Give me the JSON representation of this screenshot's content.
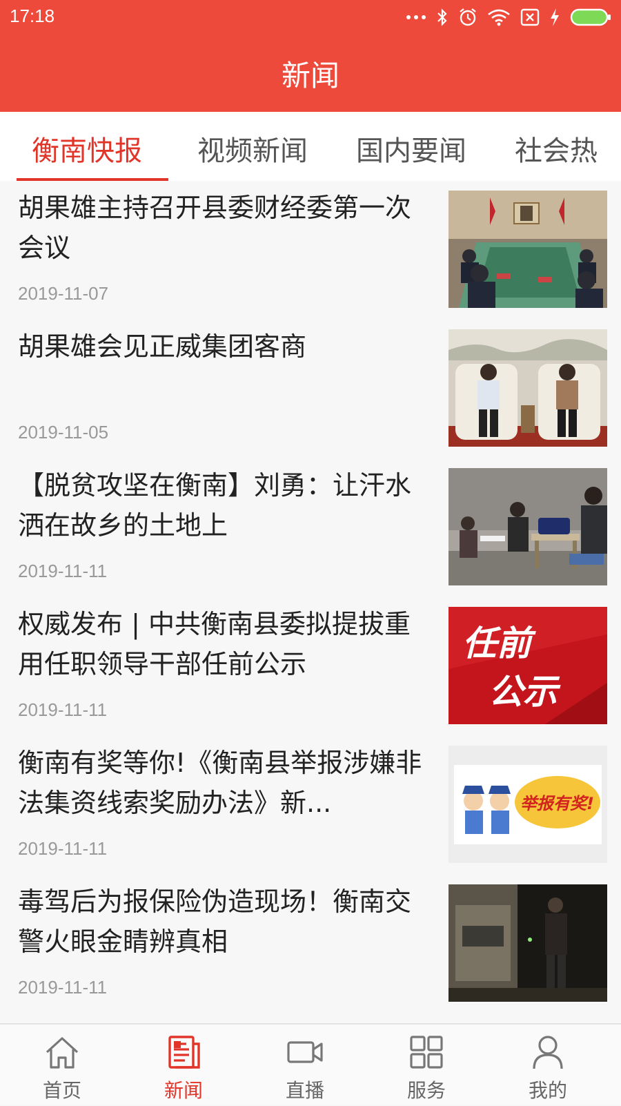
{
  "status_bar": {
    "time": "17:18"
  },
  "header": {
    "title": "新闻"
  },
  "tabs": [
    {
      "label": "衡南快报",
      "active": true
    },
    {
      "label": "视频新闻",
      "active": false
    },
    {
      "label": "国内要闻",
      "active": false
    },
    {
      "label": "社会热",
      "active": false
    }
  ],
  "news": [
    {
      "title": "胡果雄主持召开县委财经委第一次会议",
      "date": "2019-11-07",
      "thumb": "meeting-room-photo"
    },
    {
      "title": "胡果雄会见正威集团客商",
      "date": "2019-11-05",
      "thumb": "reception-photo"
    },
    {
      "title": "【脱贫攻坚在衡南】刘勇：让汗水洒在故乡的土地上",
      "date": "2019-11-11",
      "thumb": "village-visit-photo"
    },
    {
      "title": "权威发布 | 中共衡南县委拟提拔重用任职领导干部任前公示",
      "date": "2019-11-11",
      "thumb": "announcement-banner",
      "thumb_text": [
        "任前",
        "公示"
      ]
    },
    {
      "title": "衡南有奖等你!《衡南县举报涉嫌非法集资线索奖励办法》新...",
      "date": "2019-11-11",
      "thumb": "report-reward-cartoon",
      "thumb_text": "举报有奖!"
    },
    {
      "title": "毒驾后为报保险伪造现场！衡南交警火眼金睛辨真相",
      "date": "2019-11-11",
      "thumb": "night-scene-photo"
    }
  ],
  "bottom_nav": [
    {
      "label": "首页",
      "icon": "home-icon",
      "active": false
    },
    {
      "label": "新闻",
      "icon": "news-icon",
      "active": true
    },
    {
      "label": "直播",
      "icon": "video-camera-icon",
      "active": false
    },
    {
      "label": "服务",
      "icon": "grid-icon",
      "active": false
    },
    {
      "label": "我的",
      "icon": "person-icon",
      "active": false
    }
  ],
  "colors": {
    "primary": "#ee4a3b",
    "accent": "#e2352a",
    "text": "#222222",
    "muted": "#999999",
    "background": "#f7f7f7"
  }
}
